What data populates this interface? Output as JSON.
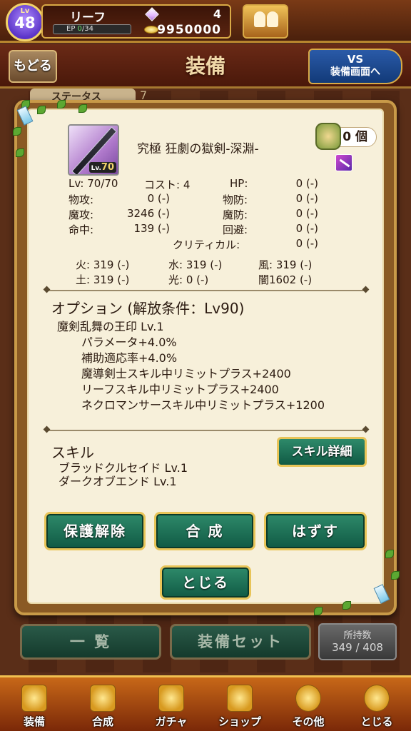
{
  "top_bar": {
    "level_tag": "Lv",
    "level": "48",
    "player_name": "リーフ",
    "ep_label": "EP",
    "ep_current": "0",
    "ep_max": "/34",
    "gems": "4",
    "coins": "9950000"
  },
  "header": {
    "back_label": "もどる",
    "title": "装備",
    "vs_label": "VS",
    "vs_sub": "装備画面へ"
  },
  "background": {
    "tab_label": "ステータス",
    "tab_num": "7"
  },
  "item": {
    "thumb_level_prefix": "Lv.",
    "thumb_level": "70",
    "name": "究極 狂劇の獄剣-深淵-",
    "count": "0 個"
  },
  "stats": {
    "lv_label": "Lv:",
    "lv_value": "70/70",
    "cost_label": "コスト:",
    "cost_value": "4",
    "hp_label": "HP:",
    "hp_value": "0 (-)",
    "patk_label": "物攻:",
    "patk_value": "0 (-)",
    "pdef_label": "物防:",
    "pdef_value": "0 (-)",
    "matk_label": "魔攻:",
    "matk_value": "3246 (-)",
    "mdef_label": "魔防:",
    "mdef_value": "0 (-)",
    "hit_label": "命中:",
    "hit_value": "139 (-)",
    "eva_label": "回避:",
    "eva_value": "0 (-)",
    "crit_label": "クリティカル:",
    "crit_value": "0 (-)",
    "fire_label": "火:",
    "fire_value": "319 (-)",
    "water_label": "水:",
    "water_value": "319 (-)",
    "wind_label": "風:",
    "wind_value": "319 (-)",
    "earth_label": "土:",
    "earth_value": "319 (-)",
    "light_label": "光:",
    "light_value": "0 (-)",
    "dark_label": "闇",
    "dark_value": "1602 (-)"
  },
  "options": {
    "title": "オプション (解放条件：Lv90)",
    "main": "魔剣乱舞の王印 Lv.1",
    "lines": [
      "パラメータ+4.0%",
      "補助適応率+4.0%",
      "魔導剣士スキル中リミットプラス+2400",
      "リーフスキル中リミットプラス+2400",
      "ネクロマンサースキル中リミットプラス+1200"
    ]
  },
  "skills": {
    "title": "スキル",
    "detail_button": "スキル詳細",
    "lines": [
      "ブラッドクルセイド Lv.1",
      "ダークオブエンド Lv.1"
    ]
  },
  "actions": {
    "unprotect": "保護解除",
    "compose": "合 成",
    "remove": "はずす",
    "close": "とじる"
  },
  "bottom": {
    "list": "一 覧",
    "equip_set": "装備セット",
    "owned_label": "所持数",
    "owned_value": "349 / 408"
  },
  "nav": {
    "items": [
      "装備",
      "合成",
      "ガチャ",
      "ショップ",
      "その他",
      "とじる"
    ]
  },
  "colors": {
    "modal_bg": "#f7f0da",
    "button_green": "#2e8a6a",
    "gold_border": "#e8c458"
  }
}
